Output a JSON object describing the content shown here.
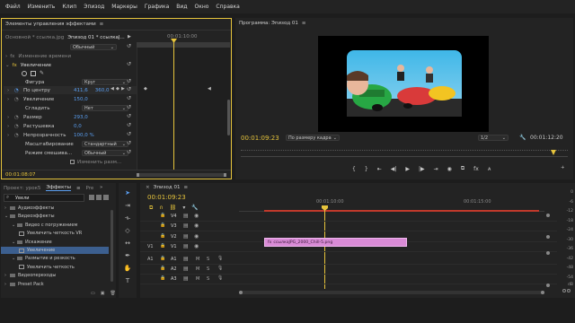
{
  "menu": [
    "Файл",
    "Изменить",
    "Клип",
    "Эпизод",
    "Маркеры",
    "Графика",
    "Вид",
    "Окно",
    "Справка"
  ],
  "effects_controls": {
    "title": "Элементы управления эффектами",
    "master_label": "Основной * ссылка.jpg",
    "sequence_label": "Эпизод 01 * ссылкаJ...",
    "ruler_time": "00:01:10:00",
    "blend_top_value": "Обычный",
    "time_reassign": "Изменение времени",
    "fx_name": "Увеличение",
    "fx_badge": "fx",
    "rows": [
      {
        "label": "Фигура",
        "value": "Круг"
      },
      {
        "label": "По центру",
        "value1": "411,6",
        "value2": "360,0"
      },
      {
        "label": "Увеличение",
        "value": "150,0"
      },
      {
        "label": "Сгладить",
        "value": "Нет"
      },
      {
        "label": "Размер",
        "value": "293,0"
      },
      {
        "label": "Растушевка",
        "value": "0,0"
      },
      {
        "label": "Непрозрачность",
        "value": "100,0 %"
      },
      {
        "label": "Масштабирование",
        "value": "Стандартный"
      },
      {
        "label": "Режим смешива...",
        "value": "Обычный"
      }
    ],
    "resize_checkbox": "Изменить разм...",
    "timecode": "00:01:08:07"
  },
  "program": {
    "title": "Программа: Эпизод 01",
    "timecode": "00:01:09:23",
    "fit": "По размеру кадра",
    "quality": "1/2",
    "duration": "00:01:12:20"
  },
  "project": {
    "tab_project": "Проект: урок5",
    "tab_effects": "Эффекты",
    "tab_extra": "Pre",
    "search_value": "Увели",
    "tree": [
      {
        "label": "Аудиоэффекты",
        "indent": 0,
        "type": "folder"
      },
      {
        "label": "Видеоэффекты",
        "indent": 0,
        "type": "folder"
      },
      {
        "label": "Видео с погружением",
        "indent": 1,
        "type": "folder"
      },
      {
        "label": "Увеличить четкость VR",
        "indent": 2,
        "type": "fx"
      },
      {
        "label": "Искажение",
        "indent": 1,
        "type": "folder"
      },
      {
        "label": "Увеличение",
        "indent": 2,
        "type": "fx",
        "selected": true
      },
      {
        "label": "Размытие и резкость",
        "indent": 1,
        "type": "folder"
      },
      {
        "label": "Увеличить четкость",
        "indent": 2,
        "type": "fx"
      },
      {
        "label": "Видеопереходы",
        "indent": 0,
        "type": "folder"
      },
      {
        "label": "Preset Pack",
        "indent": 0,
        "type": "folder"
      }
    ]
  },
  "timeline": {
    "title": "Эпизод 01",
    "timecode": "00:01:09:23",
    "ruler_mid": "00:01:10:00",
    "ruler_right": "00:01:15:00",
    "video_tracks": [
      "V4",
      "V3",
      "V2",
      "V1"
    ],
    "audio_tracks": [
      "A1",
      "A2",
      "A3"
    ],
    "clip_name": "ссылкаJPG_2000_Chill-5.png",
    "track_badges": [
      "V1",
      "A1"
    ],
    "db_scale": [
      "0",
      "-6",
      "-12",
      "-18",
      "-24",
      "-30",
      "-36",
      "-42",
      "-48",
      "-54"
    ],
    "db_unit": "dB"
  },
  "colors": {
    "accent_yellow": "#e6c43c",
    "clip_pink": "#d98bd6",
    "selected_blue": "#3c5f8f",
    "work_area_red": "#c0392b"
  }
}
